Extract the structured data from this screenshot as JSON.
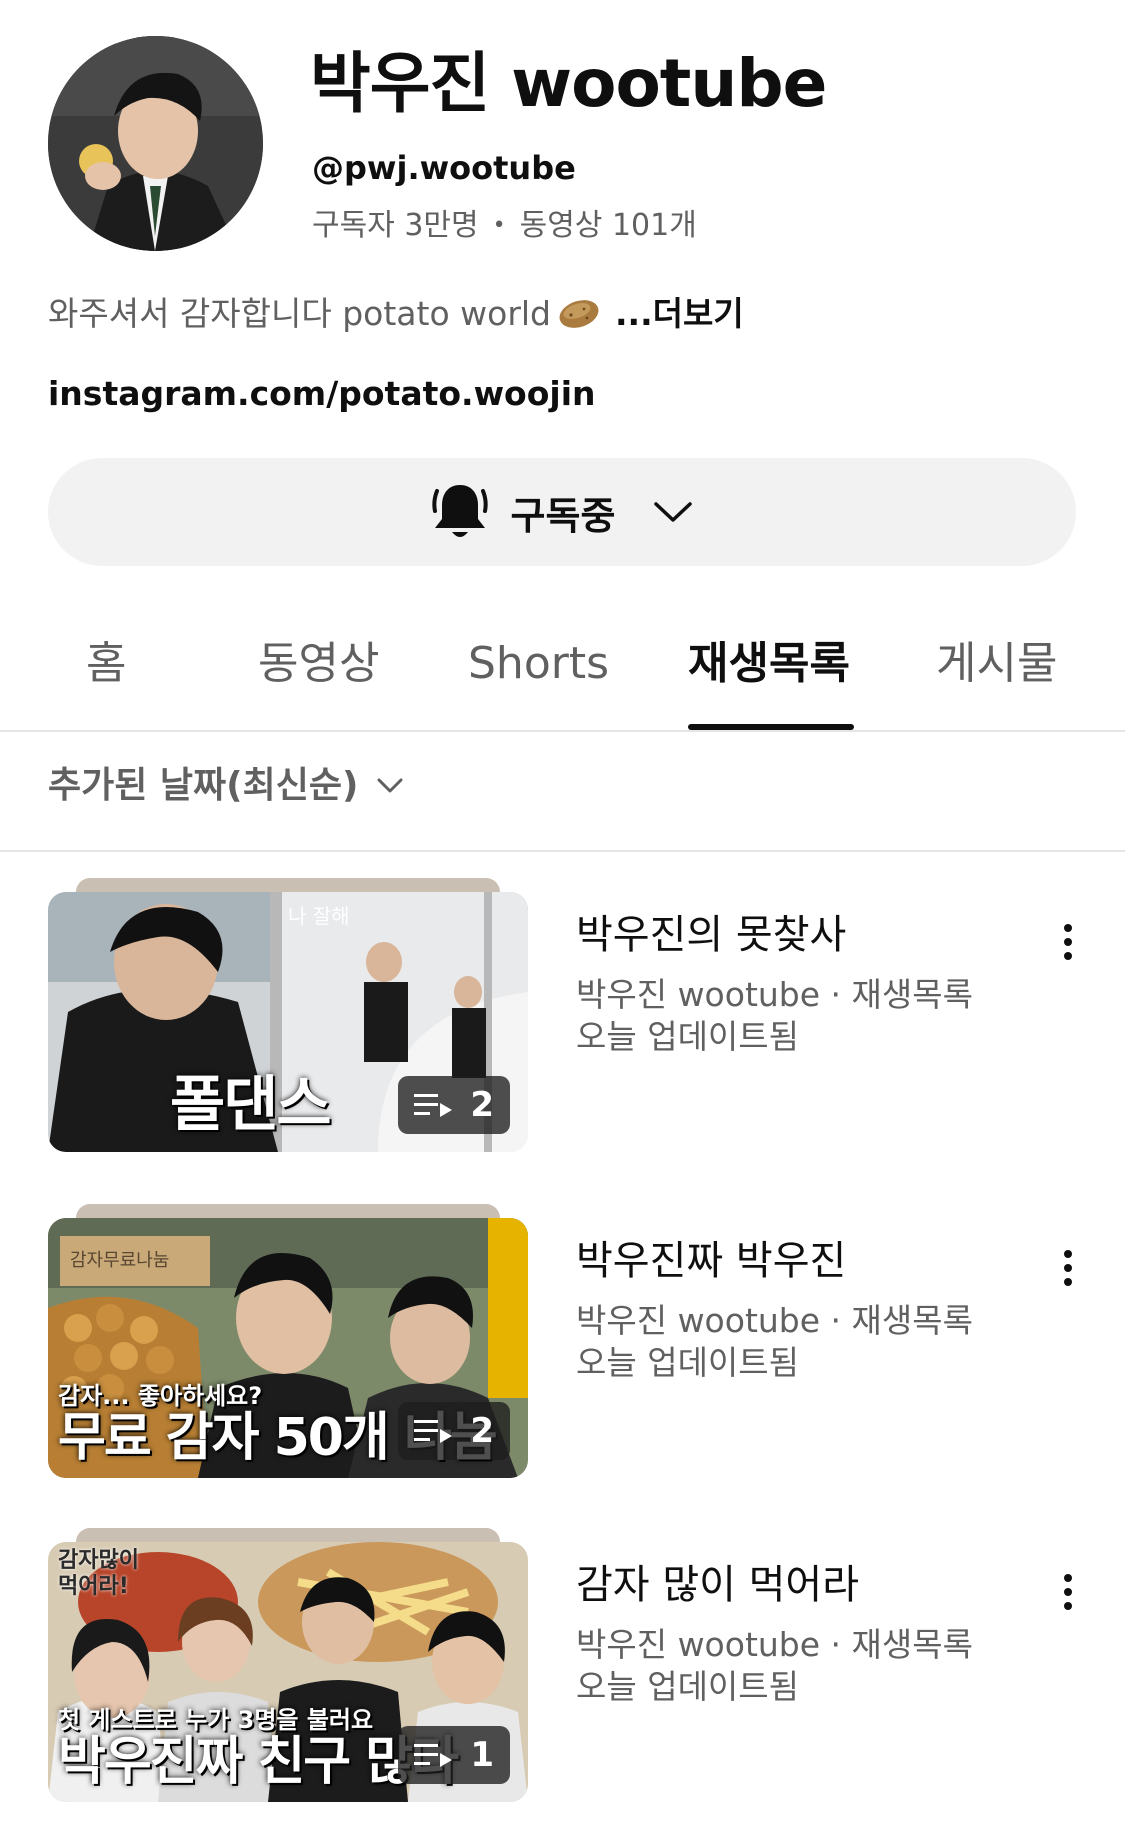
{
  "channel": {
    "name": "박우진 wootube",
    "handle": "@pwj.wootube",
    "subscribers": "구독자 3만명",
    "stats_separator": "•",
    "videos": "동영상 101개",
    "description": "와주셔서 감자합니다 potato world",
    "description_emoji": "potato-icon",
    "more_label": "...더보기",
    "link": "instagram.com/potato.woojin"
  },
  "subscribe": {
    "label": "구독중",
    "icon": "bell-icon"
  },
  "tabs": [
    {
      "label": "홈",
      "active": false
    },
    {
      "label": "동영상",
      "active": false
    },
    {
      "label": "Shorts",
      "active": false
    },
    {
      "label": "재생목록",
      "active": true
    },
    {
      "label": "게시물",
      "active": false
    }
  ],
  "sort": {
    "label": "추가된 날짜(최신순)"
  },
  "playlists": [
    {
      "title": "박우진의 못찾사",
      "meta": "박우진 wootube · 재생목록",
      "updated": "오늘 업데이트됨",
      "count": "2",
      "thumb_caption_big": "폴댄스",
      "thumb_tag": "나 잘해"
    },
    {
      "title": "박우진짜 박우진",
      "meta": "박우진 wootube · 재생목록",
      "updated": "오늘 업데이트됨",
      "count": "2",
      "thumb_caption_small": "감자... 좋아하세요?",
      "thumb_caption_big": "무료 감자 50개 나눔",
      "thumb_sign": "감자무료나눔"
    },
    {
      "title": "감자 많이 먹어라",
      "meta": "박우진 wootube · 재생목록",
      "updated": "오늘 업데이트됨",
      "count": "1",
      "thumb_caption_small": "첫 게스트로 누가 3명을 불러요",
      "thumb_caption_big": "박우진짜 친구 많다",
      "thumb_tag": "감자많이 먹어라!"
    }
  ],
  "colors": {
    "text_primary": "#0f0f0f",
    "text_secondary": "#606060",
    "button_bg": "#f2f2f2",
    "divider": "#e5e5e5"
  }
}
